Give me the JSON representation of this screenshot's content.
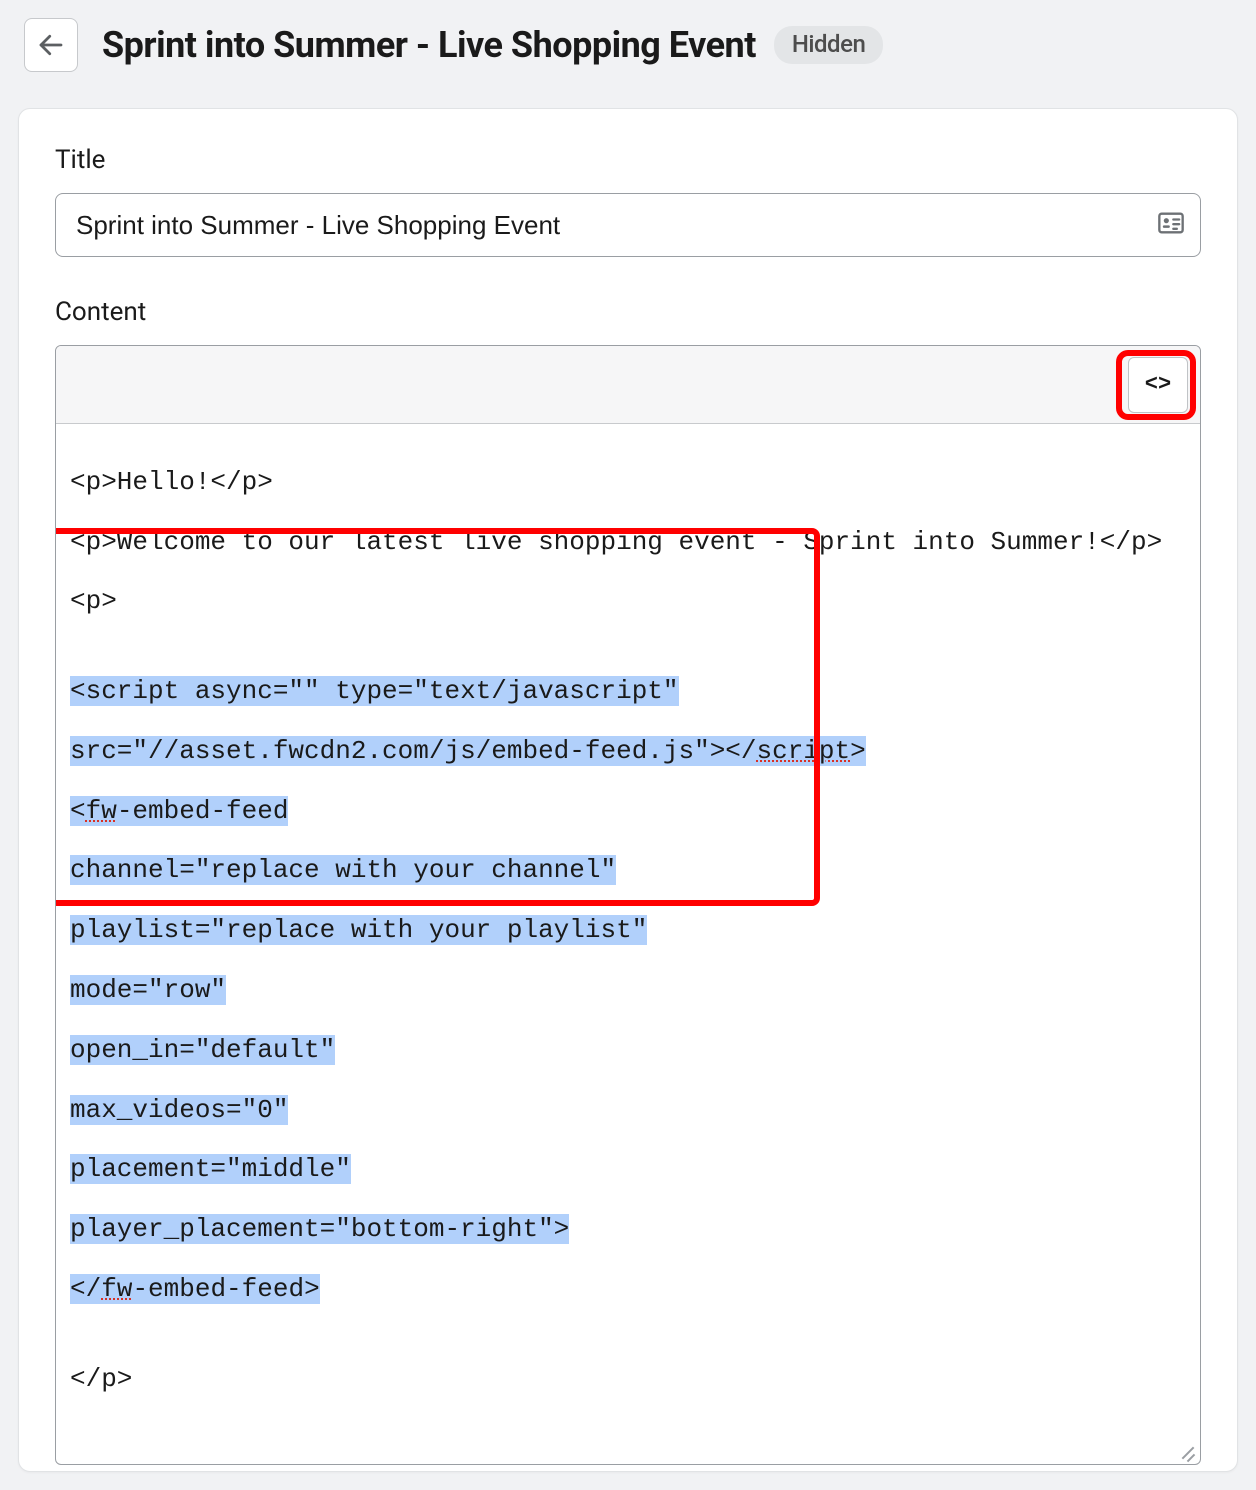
{
  "header": {
    "title": "Sprint into Summer - Live Shopping Event",
    "status_badge": "Hidden"
  },
  "form": {
    "title_label": "Title",
    "title_value": "Sprint into Summer - Live Shopping Event",
    "content_label": "Content",
    "code_toggle_label": "<>"
  },
  "editor": {
    "line1": "<p>Hello!</p>",
    "line2": "<p>Welcome to our latest live shopping event - Sprint into Summer!</p>",
    "line3": "<p>",
    "blank": "",
    "s1": "<script async=\"\" type=\"text/javascript\"",
    "s2a": "src=\"//asset.fwcdn2.com/js/embed-feed.js\"></",
    "s2b": "script",
    "s2c": ">",
    "s3a": "<",
    "s3b": "fw",
    "s3c": "-embed-feed",
    "s4": "channel=\"replace with your channel\"",
    "s5": "playlist=\"replace with your playlist\"",
    "s6": "mode=\"row\"",
    "s7": "open_in=\"default\"",
    "s8": "max_videos=\"0\"",
    "s9": "placement=\"middle\"",
    "s10": "player_placement=\"bottom-right\">",
    "s11a": "</",
    "s11b": "fw",
    "s11c": "-embed-feed>",
    "line_end": "</p>"
  }
}
